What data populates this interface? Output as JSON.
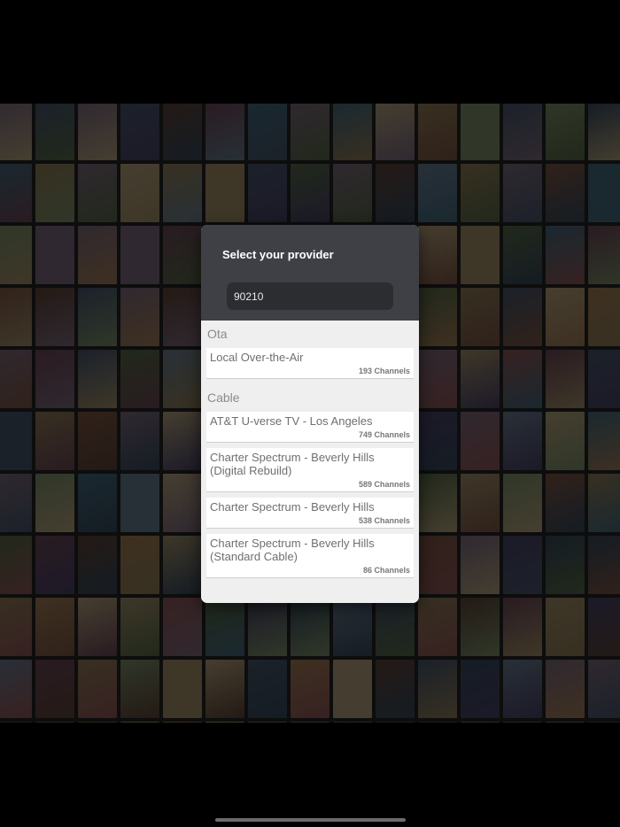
{
  "modal": {
    "title": "Select your provider",
    "zip_value": "90210"
  },
  "sections": [
    {
      "header": "Ota",
      "providers": [
        {
          "name": "Local Over-the-Air",
          "channels": "193 Channels"
        }
      ]
    },
    {
      "header": "Cable",
      "providers": [
        {
          "name": "AT&T U-verse TV - Los Angeles",
          "channels": "749 Channels"
        },
        {
          "name": "Charter Spectrum - Beverly Hills (Digital Rebuild)",
          "channels": "589 Channels"
        },
        {
          "name": "Charter Spectrum - Beverly Hills",
          "channels": "538 Channels"
        },
        {
          "name": "Charter Spectrum - Beverly Hills (Standard Cable)",
          "channels": "86 Channels"
        }
      ]
    }
  ],
  "colors": {
    "modal_header": "#3f4046",
    "modal_body": "#efefef",
    "input_bg": "#2c2d31",
    "backdrop": "#000000"
  }
}
